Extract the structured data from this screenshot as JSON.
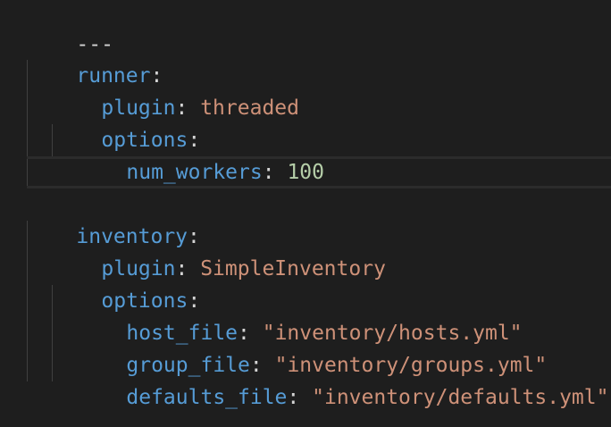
{
  "editor": {
    "doc_start": "---",
    "runner_key": "runner",
    "runner_plugin_key": "plugin",
    "runner_plugin_value": "threaded",
    "runner_options_key": "options",
    "num_workers_key": "num_workers",
    "num_workers_value": "100",
    "inventory_key": "inventory",
    "inventory_plugin_key": "plugin",
    "inventory_plugin_value": "SimpleInventory",
    "inventory_options_key": "options",
    "host_file_key": "host_file",
    "host_file_value": "\"inventory/hosts.yml\"",
    "group_file_key": "group_file",
    "group_file_value": "\"inventory/groups.yml\"",
    "defaults_file_key": "defaults_file",
    "defaults_file_value": "\"inventory/defaults.yml\"",
    "colon": ":"
  },
  "colors": {
    "background": "#1e1e1e",
    "key": "#569cd6",
    "string": "#ce9178",
    "number": "#b5cea8",
    "text": "#d4d4d4"
  }
}
